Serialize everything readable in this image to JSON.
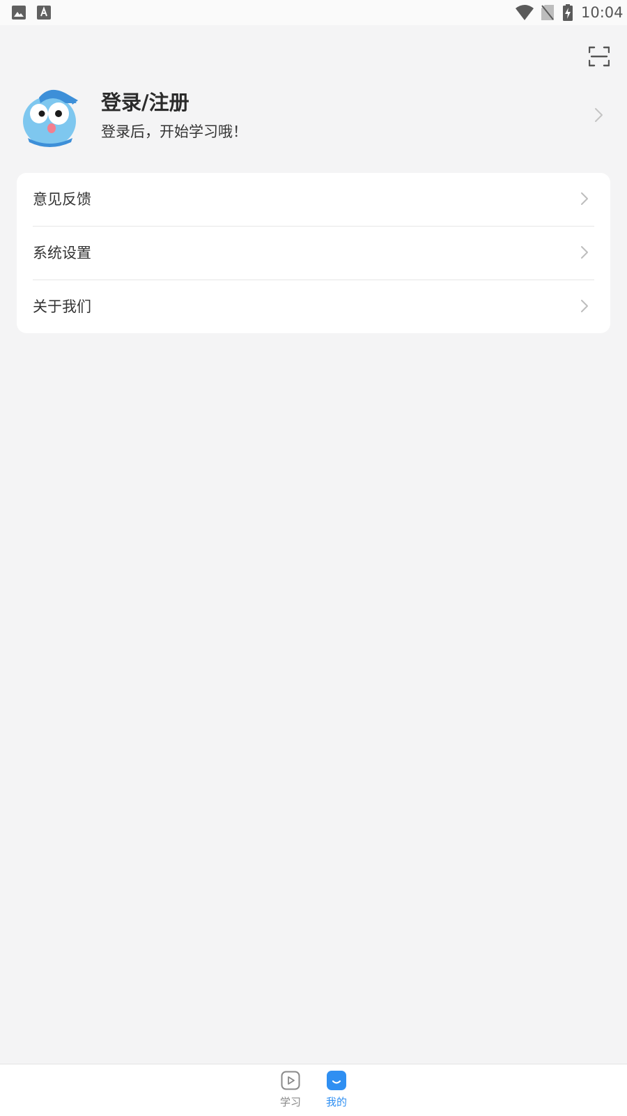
{
  "status_bar": {
    "time": "10:04",
    "icons": [
      "gallery-icon",
      "font-icon",
      "wifi-icon",
      "no-sim-icon",
      "battery-charging-icon"
    ]
  },
  "header": {
    "scan_icon": "scan-icon"
  },
  "profile": {
    "title": "登录/注册",
    "subtitle": "登录后，开始学习哦！",
    "avatar": "cartoon-avatar"
  },
  "menu": {
    "items": [
      {
        "label": "意见反馈",
        "icon": "chevron-right-icon"
      },
      {
        "label": "系统设置",
        "icon": "chevron-right-icon"
      },
      {
        "label": "关于我们",
        "icon": "chevron-right-icon"
      }
    ]
  },
  "bottom_nav": {
    "tabs": [
      {
        "label": "学习",
        "icon": "play-icon",
        "active": false
      },
      {
        "label": "我的",
        "icon": "smile-icon",
        "active": true
      }
    ]
  },
  "colors": {
    "background": "#f4f4f5",
    "card": "#ffffff",
    "accent": "#2f8ff2",
    "text": "#333333",
    "muted": "#888888"
  }
}
